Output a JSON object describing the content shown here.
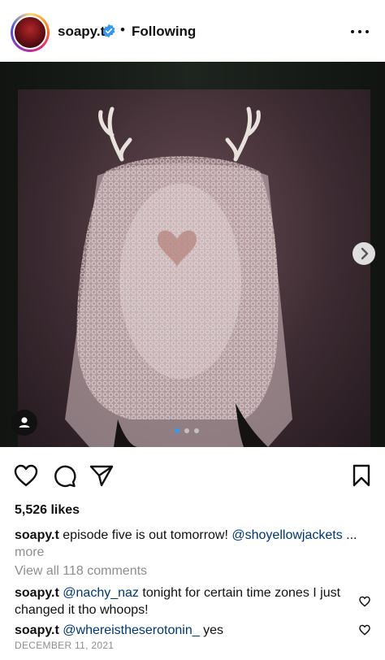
{
  "post": {
    "username": "soapy.t",
    "separator": "•",
    "follow_status": "Following",
    "likes": "5,526 likes",
    "caption": {
      "username": "soapy.t",
      "text": "episode five is out tomorrow!",
      "mention": "@shoyellowjackets",
      "ellipsis": "...",
      "more_label": "more"
    },
    "view_comments": "View all 118 comments",
    "comments": [
      {
        "username": "soapy.t",
        "mention": "@nachy_naz",
        "text": "tonight for certain time zones I just changed it tho whoops!"
      },
      {
        "username": "soapy.t",
        "mention": "@whereistheserotonin_",
        "text": "yes"
      }
    ],
    "date": "DECEMBER 11, 2021",
    "carousel": {
      "total": 3,
      "current": 1
    }
  },
  "icons": {
    "verified": "verified-badge-icon",
    "more": "more-options-icon",
    "like": "heart-icon",
    "comment": "comment-icon",
    "share": "paper-plane-icon",
    "save": "bookmark-icon",
    "next": "chevron-right-icon",
    "tag": "user-tag-icon"
  },
  "colors": {
    "verified": "#3897f0",
    "mention": "#00376b",
    "muted": "#8e8e8e"
  }
}
